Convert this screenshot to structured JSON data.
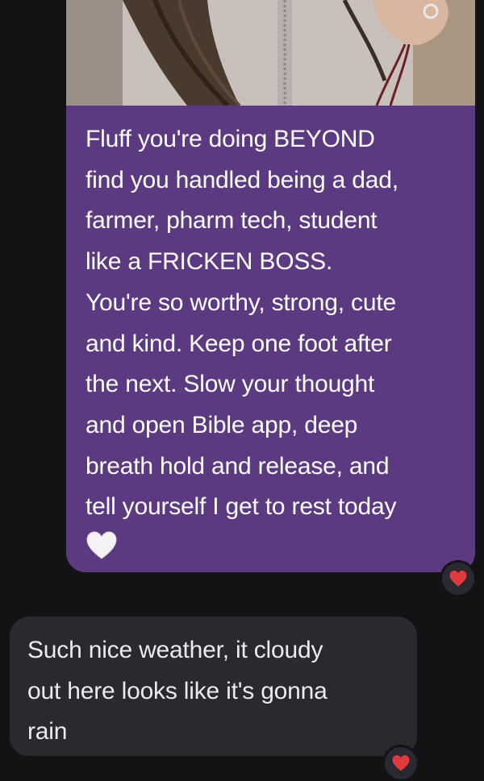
{
  "conversation": {
    "sent_message": {
      "photo_icon": "photo-attachment",
      "lines": [
        "Fluff you're doing BEYOND",
        "find you handled being a dad,",
        "farmer, pharm tech, student",
        "like a FRICKEN BOSS.",
        "You're so worthy, strong, cute",
        "and kind. Keep one foot after",
        "the next. Slow your thought",
        "and open Bible app, deep",
        "breath hold and release, and",
        "tell yourself I get to rest today"
      ],
      "emoji": "white-heart-icon",
      "reaction": "red-heart-icon"
    },
    "received_message": {
      "lines": [
        "Such nice weather, it cloudy",
        "out here looks like it's gonna",
        "rain"
      ],
      "reaction": "red-heart-icon"
    }
  },
  "colors": {
    "background": "#131215",
    "sent_bubble": "#5c3a82",
    "received_bubble": "#2b2930",
    "reaction_heart": "#e03a3e"
  }
}
